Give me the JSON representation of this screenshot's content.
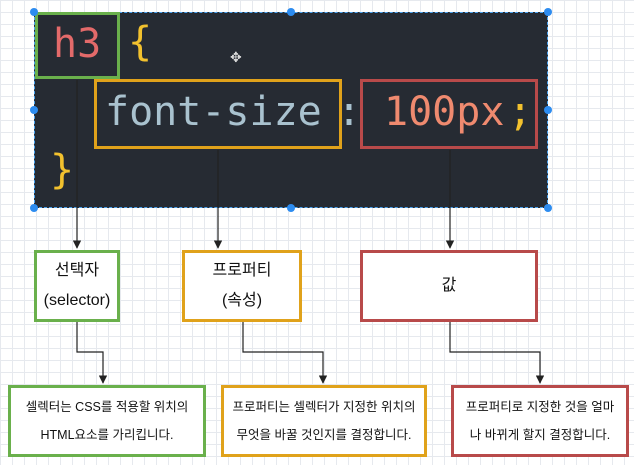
{
  "code": {
    "selector": "h3",
    "open_brace": "{",
    "property": "font-size",
    "colon": ":",
    "value": "100px",
    "semicolon": ";",
    "close_brace": "}"
  },
  "labels": {
    "selector_line1": "선택자",
    "selector_line2": "(selector)",
    "property_line1": "프로퍼티",
    "property_line2": "(속성)",
    "value_line1": "값"
  },
  "descriptions": {
    "selector_line1": "셀렉터는 CSS를 적용할 위치의",
    "selector_line2": "HTML요소를 가리킵니다.",
    "property_line1": "프로퍼티는 셀렉터가 지정한 위치의",
    "property_line2": "무엇을 바꿀 것인지를 결정합니다.",
    "value_line1": "프로퍼티로 지정한 것을 얼마",
    "value_line2": "나 바뀌게 할지 결정합니다."
  },
  "colors": {
    "selector_green": "#6ab04c",
    "property_orange": "#e0a21b",
    "value_red": "#b84a4a",
    "brace_yellow": "#f2c12e",
    "selector_text": "#e36a6a",
    "property_text": "#a9c2cf",
    "value_text": "#ef8a6f",
    "panel_bg": "#262b33"
  }
}
